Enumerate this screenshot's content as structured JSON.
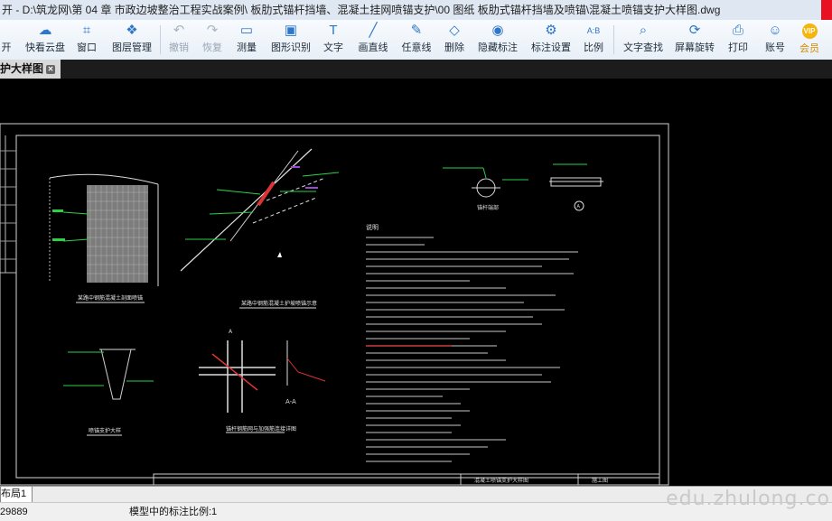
{
  "window": {
    "title": "开 - D:\\筑龙网\\第 04 章 市政边坡整治工程实战案例\\ 板肋式锚杆挡墙、混凝土挂网喷锚支护\\00 图纸 板肋式锚杆挡墙及喷锚\\混凝土喷锚支护大样图.dwg"
  },
  "toolbar": {
    "open": "开",
    "cloud": "快看云盘",
    "window": "窗口",
    "layers": "图层管理",
    "undo": "撤销",
    "redo": "恢复",
    "measure": "测量",
    "recognize": "图形识别",
    "text": "文字",
    "line": "画直线",
    "freeline": "任意线",
    "delete": "删除",
    "hide": "隐藏标注",
    "annot_settings": "标注设置",
    "ratio": "比例",
    "find_text": "文字查找",
    "rotate": "屏幕旋转",
    "print": "打印",
    "account": "账号",
    "vip": "会员"
  },
  "tab": {
    "label": "护大样图"
  },
  "drawing": {
    "notes_title": "说明",
    "view_title_1": "某路中钢筋混凝土剖面喷锚",
    "view_title_2": "某路中钢筋混凝土护坡喷锚示意",
    "view_title_3": "喷锚支护大样",
    "view_title_4": "锚杆钢筋网与加强筋连接详图",
    "section_aa": "A-A",
    "section_a": "A",
    "detail_a": "A",
    "detail_label": "锚杆端部",
    "titleblock": "混凝土喷锚支护大样图",
    "titleblock_no": "施工图"
  },
  "layout_tab": {
    "label": "布局1"
  },
  "status": {
    "coords": "29889",
    "scale_label": "模型中的标注比例:1"
  },
  "watermark": "edu.zhulong.co"
}
